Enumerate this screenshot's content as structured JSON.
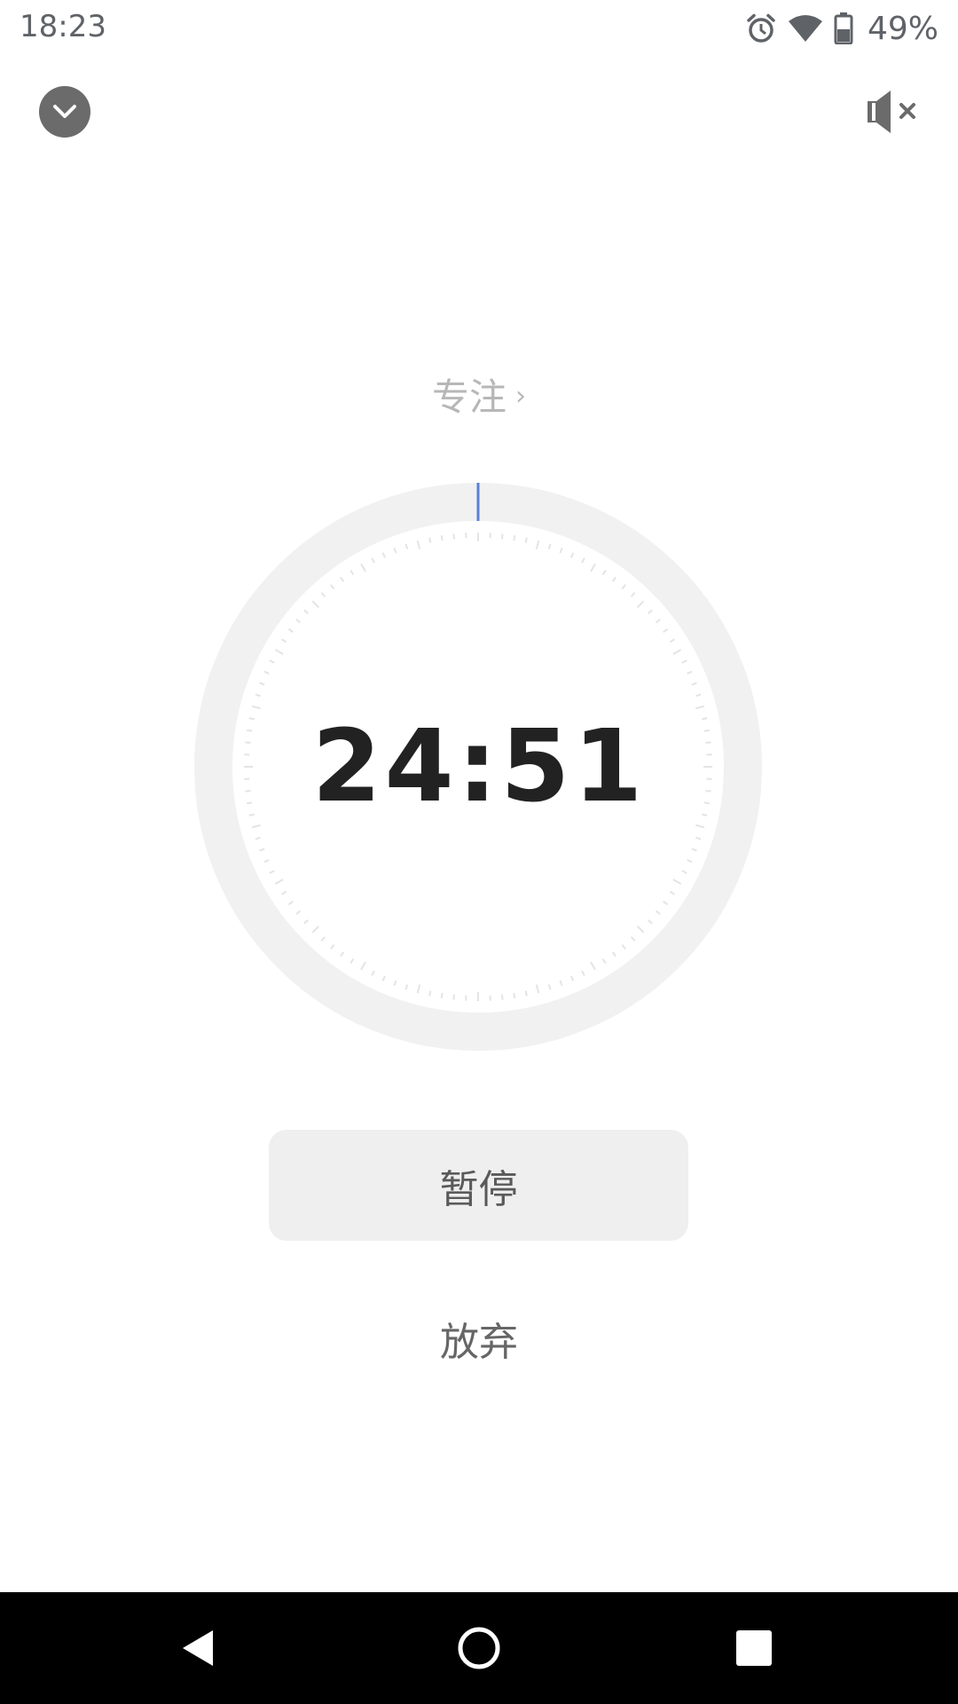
{
  "status_bar": {
    "time": "18:23",
    "battery_percent": "49%",
    "icons": [
      "alarm-icon",
      "wifi-icon",
      "battery-icon"
    ]
  },
  "header": {
    "collapse_icon": "chevron-down-icon",
    "sound_icon": "volume-mute-icon"
  },
  "session": {
    "mode_label": "专注",
    "mode_chevron": "›"
  },
  "timer": {
    "display": "24:51",
    "elapsed_fraction": 0.006,
    "accent_color": "#5b7fd6",
    "track_color": "#f1f1f1"
  },
  "actions": {
    "pause_label": "暂停",
    "abandon_label": "放弃"
  },
  "nav_bar": {
    "icons": [
      "back-icon",
      "home-icon",
      "recents-icon"
    ]
  }
}
